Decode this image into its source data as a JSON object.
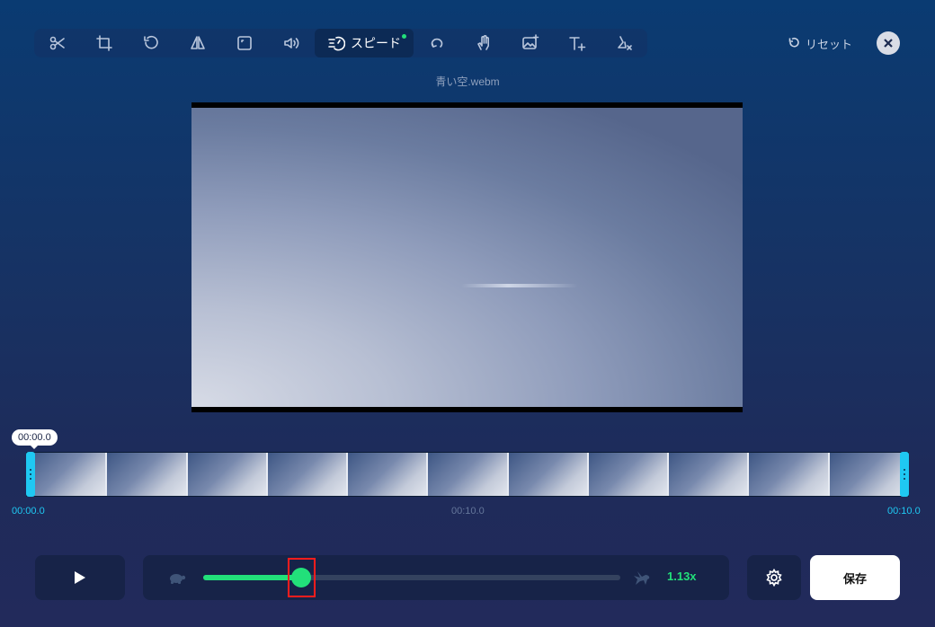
{
  "toolbar": {
    "tools": [
      {
        "icon": "scissors-icon"
      },
      {
        "icon": "crop-icon"
      },
      {
        "icon": "rotate-icon"
      },
      {
        "icon": "flip-icon"
      },
      {
        "icon": "resize-icon"
      },
      {
        "icon": "volume-icon"
      },
      {
        "icon": "speed-icon",
        "label": "スピード",
        "active": true
      },
      {
        "icon": "loop-icon"
      },
      {
        "icon": "stabilize-icon"
      },
      {
        "icon": "add-image-icon"
      },
      {
        "icon": "add-text-icon"
      },
      {
        "icon": "remove-watermark-icon"
      }
    ],
    "reset_label": "リセット"
  },
  "file": {
    "name": "青い空.webm"
  },
  "timeline": {
    "current_time": "00:00.0",
    "start_label": "00:00.0",
    "mid_label": "00:10.0",
    "end_label": "00:10.0",
    "thumbnail_count": 11
  },
  "speed": {
    "value_label": "1.13x",
    "slider_fraction": 0.235
  },
  "actions": {
    "save_label": "保存"
  },
  "colors": {
    "accent_green": "#22e07a",
    "timeline_cyan": "#1fc8f2",
    "highlight_red": "#ff1d1d"
  }
}
